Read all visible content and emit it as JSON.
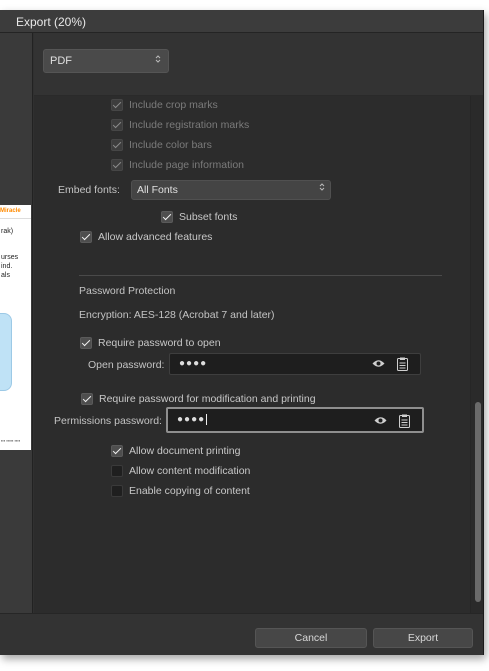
{
  "window": {
    "title": "Export (20%)"
  },
  "preview": {
    "brand_text": "Miracle",
    "lines": [
      "rak)",
      "urses",
      "ind.",
      "als"
    ]
  },
  "format": {
    "selected": "PDF",
    "chevron": "⌃⌄"
  },
  "prepress": {
    "crop_marks": {
      "label": "Include crop marks",
      "checked": true,
      "enabled": false
    },
    "registration_marks": {
      "label": "Include registration marks",
      "checked": true,
      "enabled": false
    },
    "color_bars": {
      "label": "Include color bars",
      "checked": true,
      "enabled": false
    },
    "page_information": {
      "label": "Include page information",
      "checked": true,
      "enabled": false
    }
  },
  "fonts": {
    "embed_label": "Embed  fonts:",
    "embed_selected": "All Fonts",
    "subset": {
      "label": "Subset fonts",
      "checked": true
    },
    "advanced": {
      "label": "Allow advanced features",
      "checked": true
    }
  },
  "password_protection": {
    "heading": "Password Protection",
    "encryption": "Encryption: AES-128 (Acrobat 7 and later)",
    "require_open": {
      "label": "Require password to open",
      "checked": true
    },
    "open_password": {
      "label": "Open password:",
      "value": "●●●●"
    },
    "require_modify": {
      "label": "Require password for modification and printing",
      "checked": true
    },
    "permissions_password": {
      "label": "Permissions password:",
      "value": "●●●●"
    },
    "allow_printing": {
      "label": "Allow document printing",
      "checked": true
    },
    "allow_modification": {
      "label": "Allow content modification",
      "checked": false
    },
    "allow_copying": {
      "label": "Enable copying of content",
      "checked": false
    }
  },
  "footer": {
    "cancel_label": "Cancel",
    "export_label": "Export"
  },
  "colors": {
    "window_bg": "#303030",
    "panel_bg": "#2c2c2c",
    "field_bg": "#1e1e1e",
    "text": "#c4c4c4"
  }
}
